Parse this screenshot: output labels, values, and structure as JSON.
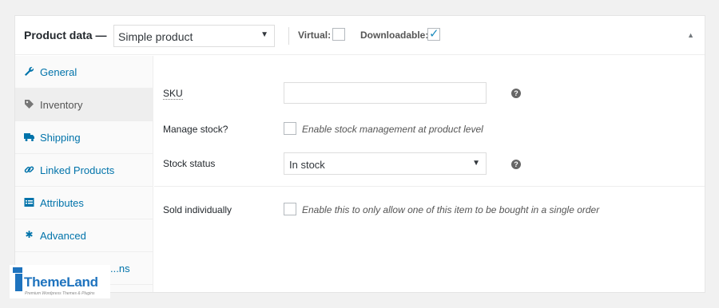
{
  "header": {
    "title": "Product data —",
    "product_type": "Simple product",
    "virtual_label": "Virtual:",
    "virtual_checked": false,
    "downloadable_label": "Downloadable:",
    "downloadable_checked": true
  },
  "sidebar": {
    "tabs": [
      {
        "label": "General",
        "icon": "wrench-icon",
        "active": false
      },
      {
        "label": "Inventory",
        "icon": "tag-icon",
        "active": true
      },
      {
        "label": "Shipping",
        "icon": "truck-icon",
        "active": false
      },
      {
        "label": "Linked Products",
        "icon": "link-icon",
        "active": false
      },
      {
        "label": "Attributes",
        "icon": "table-icon",
        "active": false
      },
      {
        "label": "Advanced",
        "icon": "gear-icon",
        "active": false
      },
      {
        "label": "...ns",
        "icon": "",
        "active": false
      }
    ]
  },
  "inventory": {
    "sku_label": "SKU",
    "sku_value": "",
    "manage_stock_label": "Manage stock?",
    "manage_stock_desc": "Enable stock management at product level",
    "stock_status_label": "Stock status",
    "stock_status_value": "In stock",
    "sold_individually_label": "Sold individually",
    "sold_individually_desc": "Enable this to only allow one of this item to be bought in a single order"
  },
  "watermark": {
    "brand": "ThemeLand",
    "tagline": "Premium Wordpress Themes & Plugins"
  },
  "colors": {
    "link": "#0073aa",
    "accent": "#1e73be"
  }
}
